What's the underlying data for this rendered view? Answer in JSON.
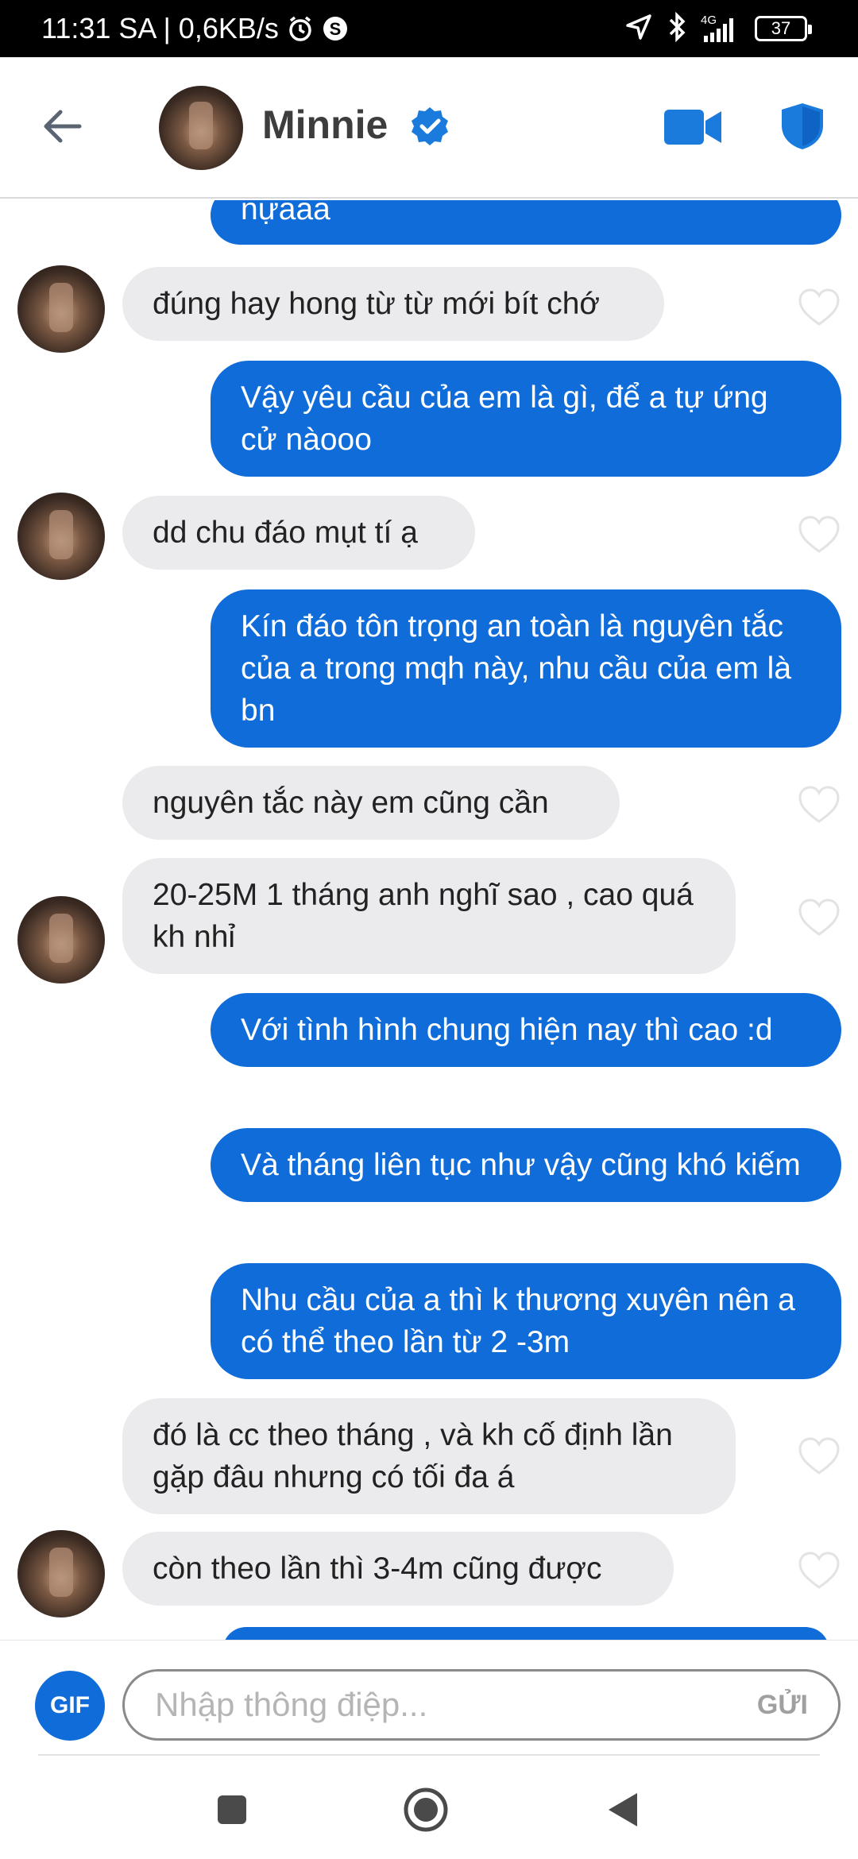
{
  "status_bar": {
    "time": "11:31 SA | 0,6KB/s",
    "network": "4G",
    "battery": "37"
  },
  "header": {
    "contact_name": "Minnie"
  },
  "messages": [
    {
      "type": "sent",
      "text": "nựaaa"
    },
    {
      "type": "recv",
      "text": "đúng hay hong từ từ mới bít chớ"
    },
    {
      "type": "sent",
      "text": "Vậy yêu cầu của em là gì, để a tự ứng cử nàooo"
    },
    {
      "type": "recv",
      "text": "dd chu đáo mụt tí ạ"
    },
    {
      "type": "sent",
      "text": "Kín đáo tôn trọng an toàn là nguyên tắc của a trong mqh này, nhu cầu của em là bn"
    },
    {
      "type": "recv",
      "text": "nguyên tắc này em cũng cần"
    },
    {
      "type": "recv",
      "text": "20-25M 1 tháng anh nghĩ sao , cao quá kh nhỉ"
    },
    {
      "type": "sent",
      "text": "Với tình hình chung hiện nay thì cao :d"
    },
    {
      "type": "sent",
      "text": "Và tháng liên tục như vậy cũng khó kiếm"
    },
    {
      "type": "sent",
      "text": "Nhu cầu của a thì k thương xuyên nên a có thể theo lần từ 2 -3m"
    },
    {
      "type": "recv",
      "text": "đó là cc theo tháng , và kh cố định lần gặp đâu nhưng có tối đa á"
    },
    {
      "type": "recv",
      "text": "còn theo lần thì 3-4m cũng được"
    }
  ],
  "composer": {
    "gif_label": "GIF",
    "placeholder": "Nhập thông điệp...",
    "send_label": "GỬI"
  },
  "colors": {
    "accent": "#0f6cd9",
    "received_bubble": "#ebebed",
    "status_bar": "#000000"
  }
}
